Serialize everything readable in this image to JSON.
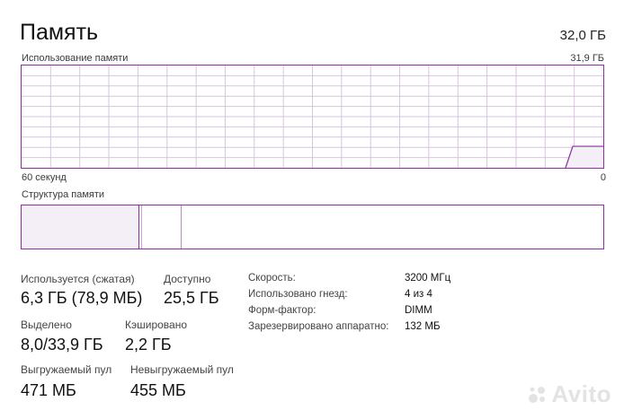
{
  "header": {
    "title": "Память",
    "total": "32,0 ГБ"
  },
  "usage_graph": {
    "label": "Использование памяти",
    "max_label": "31,9 ГБ",
    "time_left": "60 секунд",
    "time_right": "0",
    "used_fraction": 0.21,
    "line_color": "#8b2fa0",
    "grid_color": "#d9c4df"
  },
  "composition": {
    "label": "Структура памяти",
    "in_use_fraction": 0.203,
    "modified_fraction": 0.004,
    "standby_fraction": 0.068
  },
  "stats": {
    "in_use": {
      "label": "Используется (сжатая)",
      "value": "6,3 ГБ (78,9 МБ)"
    },
    "available": {
      "label": "Доступно",
      "value": "25,5 ГБ"
    },
    "committed": {
      "label": "Выделено",
      "value": "8,0/33,9 ГБ"
    },
    "cached": {
      "label": "Кэшировано",
      "value": "2,2 ГБ"
    },
    "paged": {
      "label": "Выгружаемый пул",
      "value": "471 МБ"
    },
    "nonpaged": {
      "label": "Невыгружаемый пул",
      "value": "455 МБ"
    }
  },
  "specs": [
    {
      "key": "Скорость:",
      "value": "3200 МГц"
    },
    {
      "key": "Использовано гнезд:",
      "value": "4 из 4"
    },
    {
      "key": "Форм-фактор:",
      "value": "DIMM"
    },
    {
      "key": "Зарезервировано аппаратно:",
      "value": "132 МБ"
    }
  ],
  "watermark": {
    "text": "Avito",
    "icon": "avito-logo-icon"
  }
}
